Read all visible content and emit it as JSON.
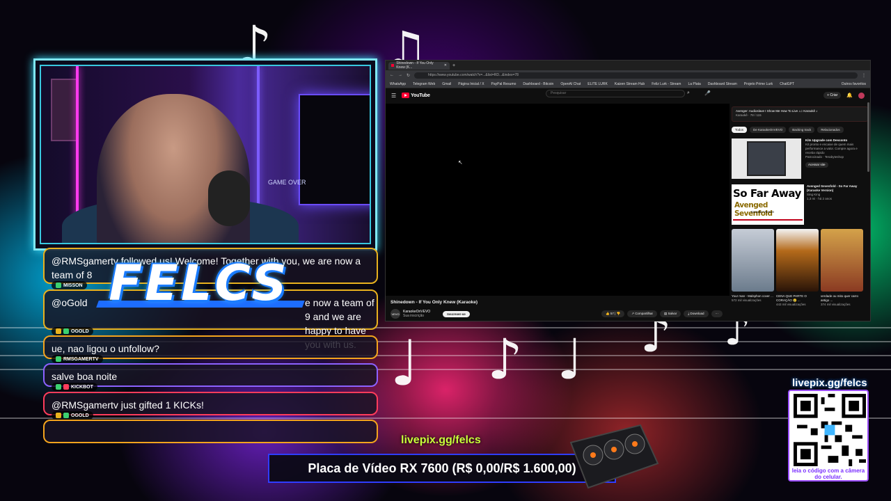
{
  "overlay": {
    "brand": "FELCS",
    "livepix_link": "livepix.gg/felcs",
    "goal_text": "Placa de Vídeo RX 7600 (R$ 0,00/R$ 1.600,00)",
    "qr_title": "livepix.gg/felcs",
    "qr_caption": "leia o código com a câmera do celular.",
    "webcam_sign": "GAME OVER"
  },
  "chat": [
    {
      "text": "@RMSgamertv followed us! Welcome! Together with you, we are now a team of 8",
      "user": "MISSON",
      "color": "#e9b21e"
    },
    {
      "text": "@oGold",
      "text_tail": "e now a team of 9 and we are happy to have you with us.",
      "user": "OGOLD",
      "color": "#e9b21e"
    },
    {
      "text": "ue, nao ligou o unfollow?",
      "user": "RMSGAMERTV",
      "color": "#f4a41d"
    },
    {
      "text": "salve boa noite",
      "user": "KICKBOT",
      "color": "#8c62ff"
    },
    {
      "text": "@RMSgamertv just gifted 1 KICKs!",
      "user": "OGOLD",
      "color": "#ff3c5b"
    },
    {
      "text": "",
      "user": "",
      "color": "#f4a41d"
    }
  ],
  "browser": {
    "tab_title": "Shinedown - If You Only Knew (K...",
    "url": "https://www.youtube.com/watch?v=...&list=RD...&index=78",
    "bookmarks": [
      "WhatsApp",
      "Telegram Web",
      "Gmail",
      "Página Inicial / X",
      "PayPal Resumo",
      "Dashboard - Bitcoin",
      "OpenAI Chat",
      "ELITE LURK",
      "Kaizen Stream Hub",
      "Feliz Lurk - Stream",
      "La Plata",
      "Dashboard Stream",
      "Projeto Prime Lurk",
      "ChatGPT",
      "Outros favoritos"
    ],
    "yt_brand": "YouTube",
    "search_placeholder": "Pesquisar",
    "create_label": "+ Criar",
    "video_title": "Shinedown - If You Only Knew (Karaoke)",
    "channel": "KaraokeOnVEVO",
    "channel_subs": "Sua inscrição",
    "subscribe_label": "Inscrever-se",
    "likes": "57",
    "share_label": "Compartilhar",
    "save_label": "Salvar",
    "download_label": "Download",
    "playlist_title": "Avenger: Audioslave I Show Me How To Live ♪♫ Karaokê ♪",
    "playlist_sub": "Karaokê · 78 / 115",
    "chips": [
      "Todos",
      "De KaraokeOnVEVO",
      "Backing track",
      "Relacionados"
    ],
    "ad_title": "Kits Upgrade com Desconto",
    "ad_desc": "Kit pronto e encaixe de quem mais performance a valor. Compre agora e receba rápido",
    "ad_sponsor": "Patrocinado · Terabyteshop",
    "ad_button": "Acessar site",
    "sf_title_1": "So Far Away",
    "sf_title_2": "Avenged Sevenfold",
    "sf_sub": "Karaoke Version",
    "sf_video_title": "Avenged Sevenfold - So Far Away (Karaoke Version)",
    "sf_channel": "Sing King",
    "sf_meta": "1,3 mi · há 2 anos",
    "shorts": [
      {
        "title": "Your man - Malsphon cover ...",
        "views": "572 mil visualizações"
      },
      {
        "title": "CENA QUE PARTE O CORAÇÃO 😢 ...",
        "views": "443 mil visualizações"
      },
      {
        "title": "verdade ou mito quer carro antigo ...",
        "views": "374 mil visualizações"
      }
    ]
  }
}
